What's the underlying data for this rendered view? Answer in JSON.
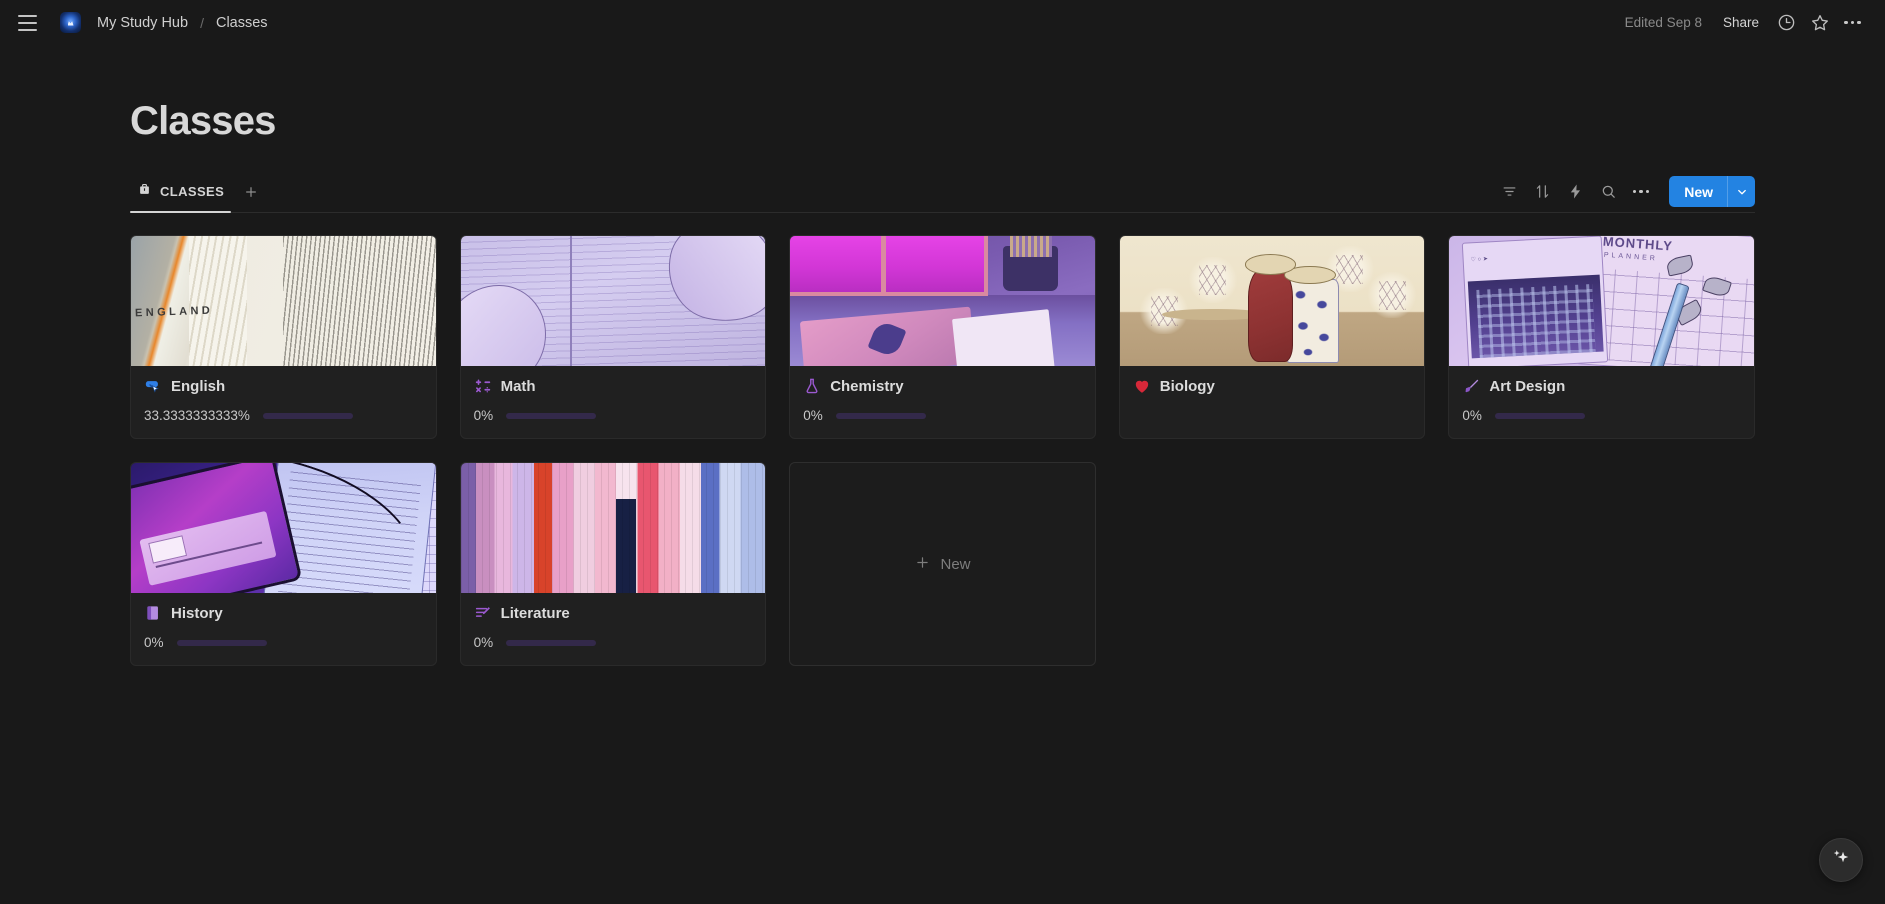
{
  "topbar": {
    "menu_icon": "hamburger-menu-icon",
    "workspace_icon": "study-hub-avatar-icon",
    "breadcrumb": {
      "parent": "My Study Hub",
      "separator": "/",
      "current": "Classes"
    },
    "edited_label": "Edited Sep 8",
    "share_label": "Share",
    "history_icon": "clock-history-icon",
    "favorite_icon": "star-icon",
    "more_icon": "more-options-icon"
  },
  "page": {
    "title": "Classes"
  },
  "database": {
    "view_tab": {
      "icon": "briefcase-icon",
      "label": "CLASSES"
    },
    "add_view_label": "+",
    "toolbar": {
      "filter_icon": "filter-icon",
      "sort_icon": "sort-icon",
      "automation_icon": "lightning-automation-icon",
      "search_icon": "search-icon",
      "more_icon": "more-options-icon",
      "new_label": "New",
      "new_caret_icon": "chevron-down-icon"
    },
    "new_card_label": "New",
    "new_card_icon": "plus-icon"
  },
  "cards": [
    {
      "title": "English",
      "emoji": "mouse-pointer-icon",
      "cover": "england-map-dictionary",
      "progress_label": "33.3333333333%",
      "progress_percent": 33.3333333333,
      "has_progress": true
    },
    {
      "title": "Math",
      "emoji": "math-symbols-icon",
      "cover": "notebook-handwriting",
      "progress_label": "0%",
      "progress_percent": 0,
      "has_progress": true
    },
    {
      "title": "Chemistry",
      "emoji": "flask-icon",
      "cover": "purple-desk-window",
      "progress_label": "0%",
      "progress_percent": 0,
      "has_progress": true
    },
    {
      "title": "Biology",
      "emoji": "heart-icon",
      "cover": "ukiyo-e-figures",
      "progress_label": "",
      "progress_percent": null,
      "has_progress": false
    },
    {
      "title": "Art Design",
      "emoji": "paintbrush-icon",
      "cover": "monthly-planner",
      "progress_label": "0%",
      "progress_percent": 0,
      "has_progress": true
    },
    {
      "title": "History",
      "emoji": "closed-book-icon",
      "cover": "phone-music-notebook",
      "progress_label": "0%",
      "progress_percent": 0,
      "has_progress": true
    },
    {
      "title": "Literature",
      "emoji": "memo-pencil-icon",
      "cover": "japanese-book-spines",
      "progress_label": "0%",
      "progress_percent": 0,
      "has_progress": true
    }
  ],
  "ai_button": {
    "icon": "ai-sparkle-icon"
  },
  "colors": {
    "page_background": "#191919",
    "card_background": "#202020",
    "accent_blue": "#2383e2",
    "progress_fill": "#8054bd",
    "progress_track": "#33294a",
    "text_primary": "#d4d4d4",
    "text_muted": "#8a8a8a"
  }
}
